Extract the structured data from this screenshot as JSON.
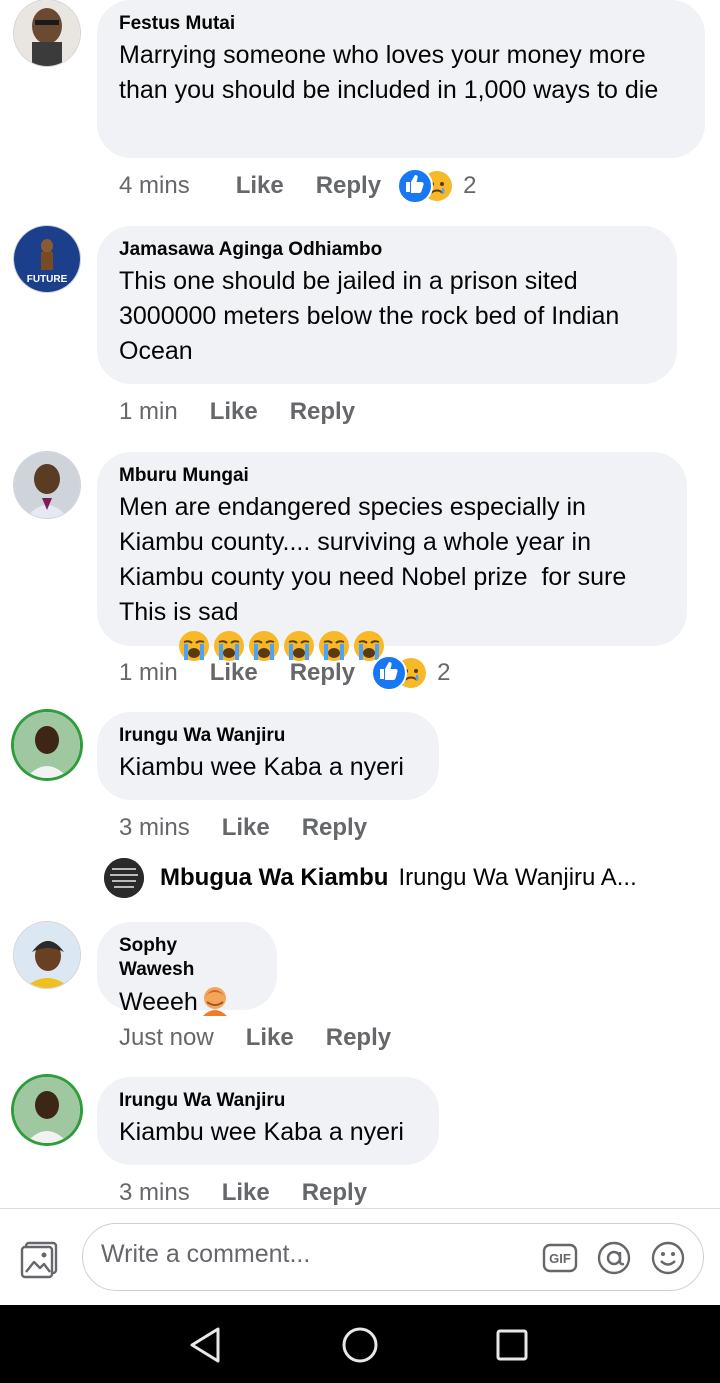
{
  "comments": [
    {
      "name": "Festus Mutai",
      "text": "Marrying someone who loves your money more than you should be included in 1,000 ways to die",
      "time": "4 mins",
      "like": "Like",
      "reply": "Reply",
      "reaction_count": "2"
    },
    {
      "name": "Jamasawa Aginga Odhiambo",
      "avatar_text": "FUTURE",
      "text": "This one should be jailed in a prison sited 3000000 meters below the rock bed of Indian Ocean",
      "time": "1 min",
      "like": "Like",
      "reply": "Reply"
    },
    {
      "name": "Mburu Mungai",
      "text_lines": [
        "Men are endangered species especially in",
        "Kiambu county.... surviving a whole year in",
        "Kiambu county you need Nobel prize  for sure",
        "This is sad"
      ],
      "time": "1 min",
      "like": "Like",
      "reply": "Reply",
      "reaction_count": "2"
    },
    {
      "name": "Irungu Wa Wanjiru",
      "text": "Kiambu wee Kaba a nyeri",
      "time": "3 mins",
      "like": "Like",
      "reply": "Reply"
    },
    {
      "name": "Sophy Wawesh",
      "text": "Weeeh",
      "time": "Just now",
      "like": "Like",
      "reply": "Reply"
    },
    {
      "name": "Irungu Wa Wanjiru",
      "text": "Kiambu wee Kaba a nyeri",
      "time": "3 mins",
      "like": "Like",
      "reply": "Reply"
    }
  ],
  "reply_preview": {
    "name": "Mbugua Wa Kiambu",
    "snippet": "Irungu Wa Wanjiru A..."
  },
  "composer": {
    "placeholder": "Write a comment...",
    "gif_label": "GIF"
  },
  "icons": {
    "reaction_like": "thumbs-up-icon",
    "reaction_sad": "sad-face-icon",
    "photo": "photo-icon",
    "gif": "gif-icon",
    "mention": "at-icon",
    "emoji": "smiley-icon",
    "back": "back-triangle-icon",
    "home": "home-circle-icon",
    "recents": "recents-square-icon"
  },
  "colors": {
    "bubble": "#f0f2f5",
    "meta": "#65676b",
    "like_blue": "#1877f2",
    "sad_yellow": "#f7b928"
  }
}
